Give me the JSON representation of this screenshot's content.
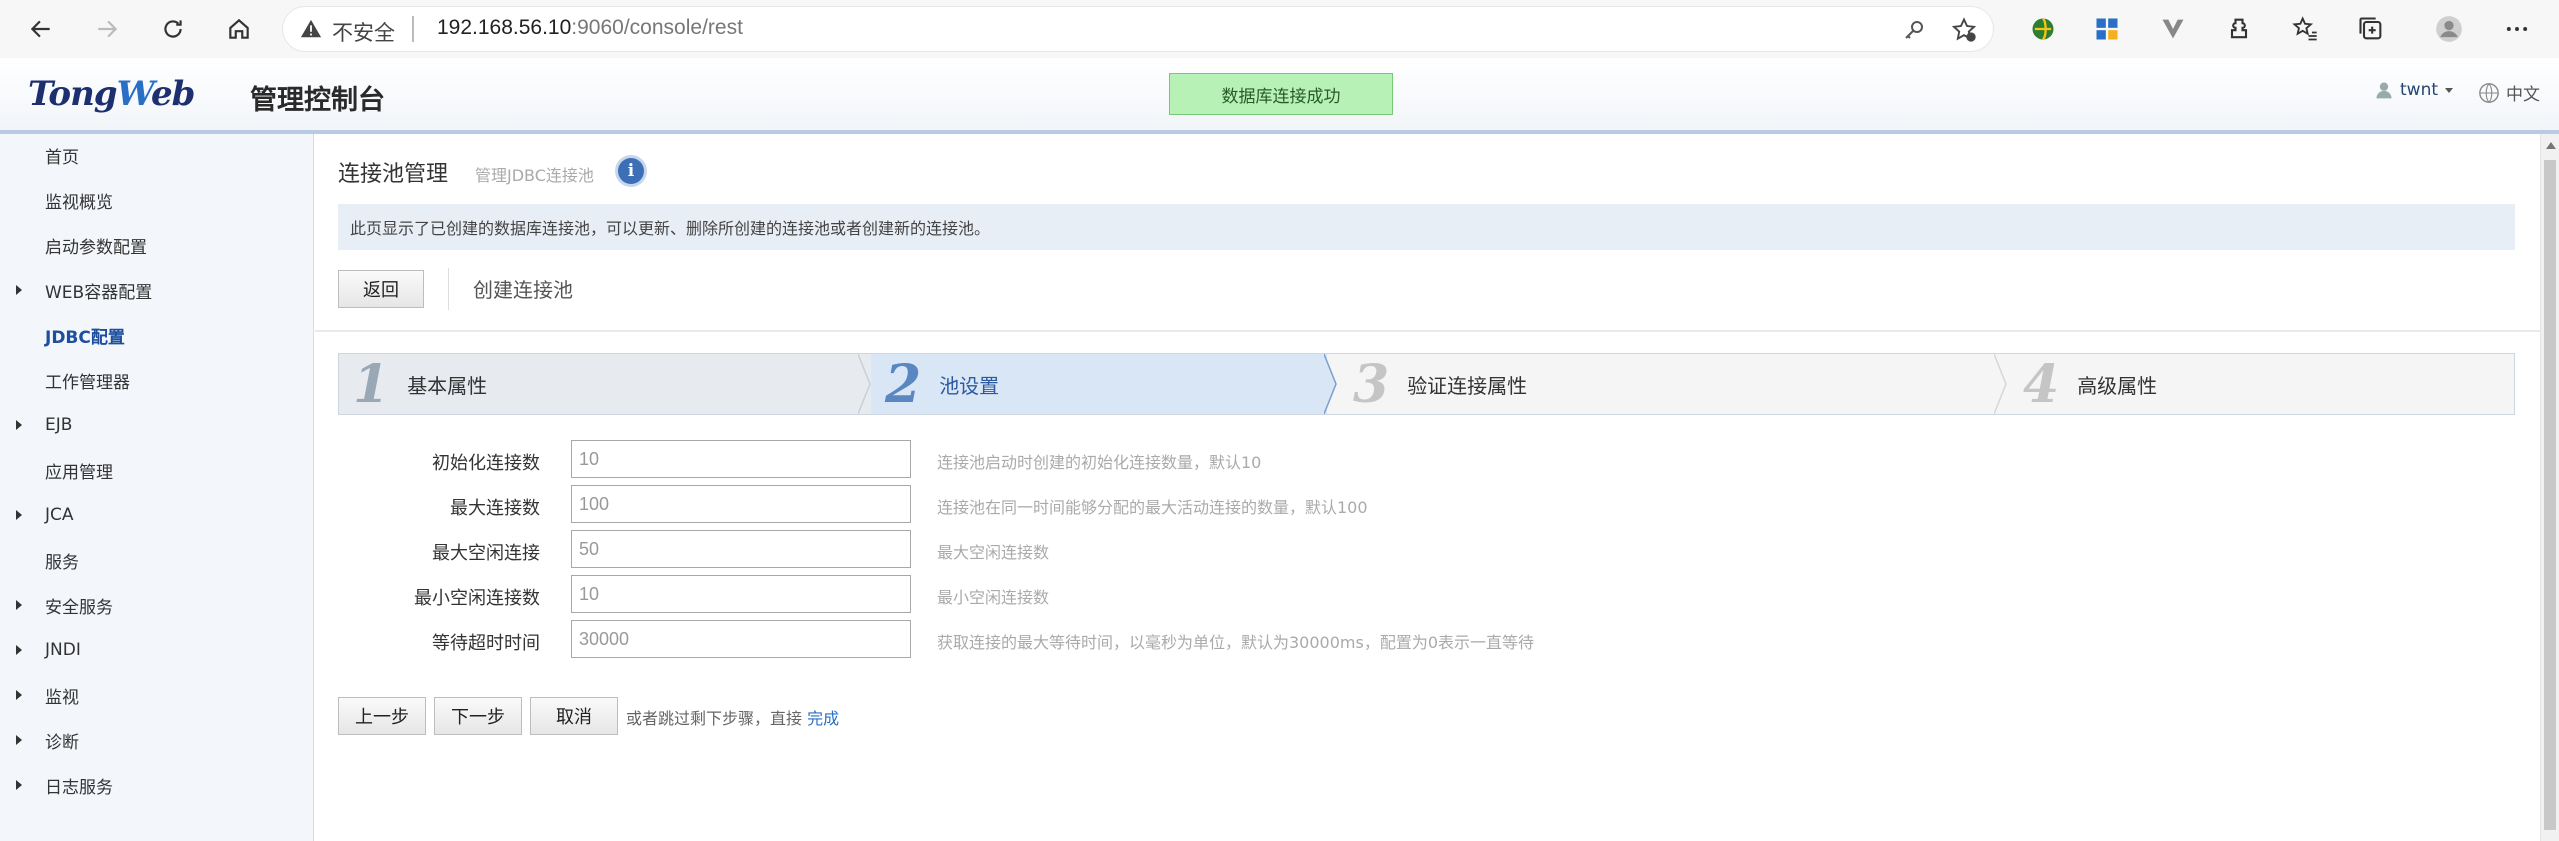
{
  "browser": {
    "insecure_label": "不安全",
    "url_host": "192.168.56.10",
    "url_rest": ":9060/console/rest",
    "icons": [
      "back-icon",
      "forward-icon",
      "reload-icon",
      "home-icon",
      "warning-icon",
      "key-icon",
      "favorite-add-icon",
      "extension-icon",
      "apps-icon",
      "vpn-icon",
      "puzzle-icon",
      "favorites-icon",
      "collections-icon",
      "profile-icon",
      "more-icon"
    ]
  },
  "header": {
    "logo_tong": "Tong",
    "logo_w": "W",
    "logo_eb": "eb",
    "logo_suffix": "管理控制台",
    "status_message": "数据库连接成功",
    "user": "twnt",
    "language": "中文"
  },
  "sidebar": {
    "items": [
      {
        "label": "首页",
        "expandable": false,
        "active": false
      },
      {
        "label": "监视概览",
        "expandable": false,
        "active": false
      },
      {
        "label": "启动参数配置",
        "expandable": false,
        "active": false
      },
      {
        "label": "WEB容器配置",
        "expandable": true,
        "active": false
      },
      {
        "label": "JDBC配置",
        "expandable": false,
        "active": true
      },
      {
        "label": "工作管理器",
        "expandable": false,
        "active": false
      },
      {
        "label": "EJB",
        "expandable": true,
        "active": false
      },
      {
        "label": "应用管理",
        "expandable": false,
        "active": false
      },
      {
        "label": "JCA",
        "expandable": true,
        "active": false
      },
      {
        "label": "服务",
        "expandable": false,
        "active": false
      },
      {
        "label": "安全服务",
        "expandable": true,
        "active": false
      },
      {
        "label": "JNDI",
        "expandable": true,
        "active": false
      },
      {
        "label": "监视",
        "expandable": true,
        "active": false
      },
      {
        "label": "诊断",
        "expandable": true,
        "active": false
      },
      {
        "label": "日志服务",
        "expandable": true,
        "active": false
      }
    ]
  },
  "main": {
    "title": "连接池管理",
    "subtitle": "管理JDBC连接池",
    "info_text": "此页显示了已创建的数据库连接池，可以更新、删除所创建的连接池或者创建新的连接池。",
    "back_button": "返回",
    "create_label": "创建连接池",
    "steps": [
      {
        "num": "1",
        "label": "基本属性",
        "state": "done"
      },
      {
        "num": "2",
        "label": "池设置",
        "state": "active"
      },
      {
        "num": "3",
        "label": "验证连接属性",
        "state": "pending"
      },
      {
        "num": "4",
        "label": "高级属性",
        "state": "pending"
      }
    ],
    "fields": [
      {
        "label": "初始化连接数",
        "value": "10",
        "hint": "连接池启动时创建的初始化连接数量，默认10"
      },
      {
        "label": "最大连接数",
        "value": "100",
        "hint": "连接池在同一时间能够分配的最大活动连接的数量，默认100"
      },
      {
        "label": "最大空闲连接",
        "value": "50",
        "hint": "最大空闲连接数"
      },
      {
        "label": "最小空闲连接数",
        "value": "10",
        "hint": "最小空闲连接数"
      },
      {
        "label": "等待超时时间",
        "value": "30000",
        "hint": "获取连接的最大等待时间，以毫秒为单位，默认为30000ms，配置为0表示一直等待"
      }
    ],
    "prev_button": "上一步",
    "next_button": "下一步",
    "cancel_button": "取消",
    "skip_text": "或者跳过剩下步骤，直接",
    "finish_link": "完成"
  }
}
